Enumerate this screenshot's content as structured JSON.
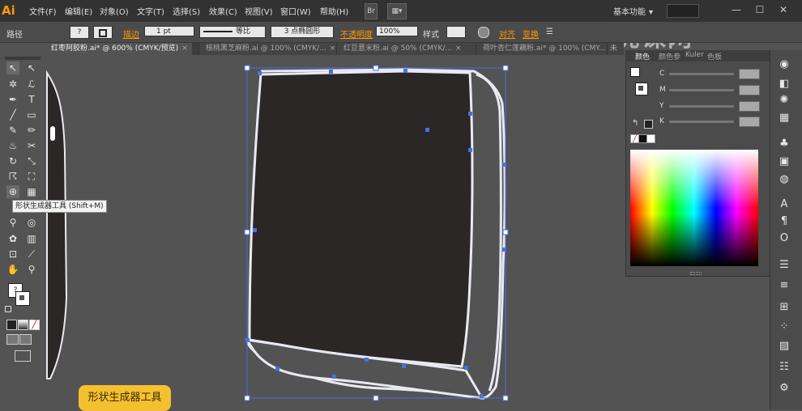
{
  "app": {
    "logo": "Ai",
    "workspace": "基本功能",
    "workspace_arrow": "▾"
  },
  "menu": {
    "items": [
      "文件(F)",
      "编辑(E)",
      "对象(O)",
      "文字(T)",
      "选择(S)",
      "效果(C)",
      "视图(V)",
      "窗口(W)",
      "帮助(H)"
    ],
    "bridge": "Br",
    "arrange": "▦▾"
  },
  "window_controls": {
    "minimize": "—",
    "maximize": "☐",
    "close": "✕"
  },
  "control_bar": {
    "object_type": "路径",
    "fill_swatch": "?",
    "stroke_label": "描边",
    "stroke_weight": "1 pt",
    "profile_label": "等比",
    "brush_label": "3 点椭圆形",
    "opacity_label": "不透明度",
    "opacity_value": "100%",
    "style_label": "样式",
    "align_label": "对齐",
    "transform_label": "变换"
  },
  "tabs": [
    {
      "label": "红枣阿胶粉.ai* @ 600% (CMYK/预览)",
      "close": "×",
      "active": true
    },
    {
      "label": "核桃黑芝麻粉.ai @ 100% (CMYK/...",
      "close": "×",
      "active": false
    },
    {
      "label": "红豆薏米粉.ai @ 50% (CMYK/...",
      "close": "×",
      "active": false
    },
    {
      "label": "荷叶杏仁莲藕粉.ai* @ 100% (CMY...",
      "close": "×",
      "active": false
    },
    {
      "label": "未",
      "close": "",
      "active": false
    }
  ],
  "tooltip": "形状生成器工具 (Shift+M)",
  "caption": "形状生成器工具",
  "color_panel": {
    "tabs": [
      "颜色",
      "颜色参",
      "Kuler",
      "色板"
    ],
    "channels": [
      "C",
      "M",
      "Y",
      "K"
    ],
    "colors": {
      "spectrum_start": "#ff0000",
      "canvas_bg": "#535353",
      "shape_fill": "#2b2727",
      "selection": "#4a6fe0"
    }
  },
  "tools": [
    "selection-arrow",
    "direct-selection",
    "magic-wand",
    "lasso",
    "pen",
    "type",
    "line",
    "rectangle",
    "paintbrush",
    "pencil",
    "blob-brush",
    "eraser",
    "rotate",
    "scale",
    "warp",
    "free-transform",
    "shape-builder",
    "perspective-grid",
    "mesh",
    "gradient",
    "eyedropper",
    "blend",
    "symbol-sprayer",
    "column-graph",
    "artboard",
    "slice",
    "hand",
    "zoom"
  ],
  "watermark": "虎课网"
}
